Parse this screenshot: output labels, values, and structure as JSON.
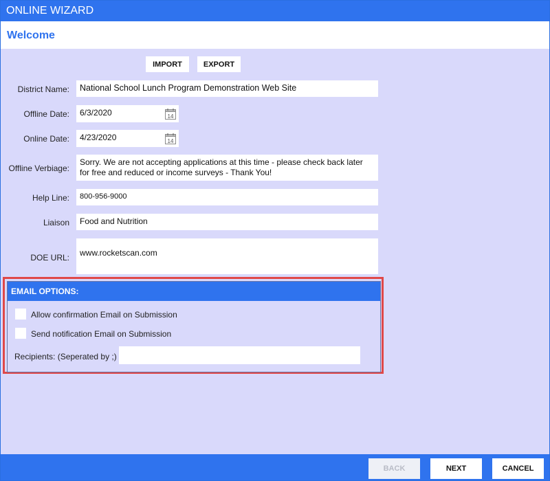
{
  "window": {
    "title": "ONLINE WIZARD"
  },
  "header": {
    "title": "Welcome"
  },
  "toolbar": {
    "import_label": "IMPORT",
    "export_label": "EXPORT"
  },
  "form": {
    "district_name": {
      "label": "District Name:",
      "value": "National School Lunch Program Demonstration Web Site"
    },
    "offline_date": {
      "label": "Offline Date:",
      "value": "6/3/2020"
    },
    "online_date": {
      "label": "Online Date:",
      "value": "4/23/2020"
    },
    "offline_verbiage": {
      "label": "Offline Verbiage:",
      "value": "Sorry. We are not accepting applications at this time - please check back later for free and reduced or income surveys - Thank You!"
    },
    "help_line": {
      "label": "Help Line:",
      "value": "800-956-9000"
    },
    "liaison": {
      "label": "Liaison",
      "value": "Food and Nutrition"
    },
    "doe_url": {
      "label": "DOE URL:",
      "value": "www.rocketscan.com"
    }
  },
  "calendar": {
    "day_label": "14"
  },
  "email_options": {
    "title": "EMAIL OPTIONS:",
    "allow_confirmation_label": "Allow confirmation Email on Submission",
    "send_notification_label": "Send notification Email on Submission",
    "recipients_label": "Recipients: (Seperated by ;)",
    "recipients_value": "",
    "allow_confirmation_checked": false,
    "send_notification_checked": false
  },
  "footer": {
    "back_label": "BACK",
    "next_label": "NEXT",
    "cancel_label": "CANCEL"
  },
  "colors": {
    "accent": "#2f73ee",
    "background": "#d9d9fb",
    "highlight": "#e04848"
  }
}
